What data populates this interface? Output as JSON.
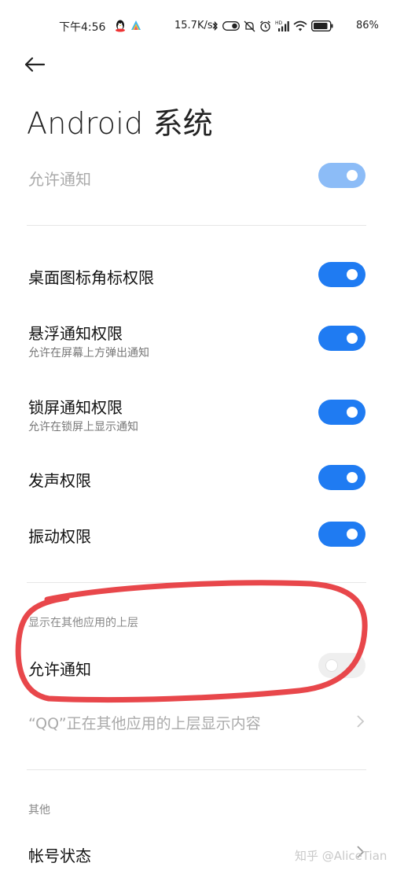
{
  "status_bar": {
    "time": "下午4:56",
    "net_speed": "15.7K/s",
    "battery_percent": "86%",
    "icons": [
      "qq-penguin-icon",
      "bird-app-icon",
      "bluetooth-icon",
      "toggle-icon",
      "mute-icon",
      "alarm-icon",
      "hd-signal-icon",
      "wifi-icon",
      "battery-icon"
    ]
  },
  "header": {
    "back_icon": "back-arrow-icon",
    "title": "Android 系统"
  },
  "allow_notifications_top": {
    "label": "允许通知",
    "state": "on",
    "enabled": false
  },
  "permissions": [
    {
      "title": "桌面图标角标权限",
      "subtitle": "",
      "state": "on"
    },
    {
      "title": "悬浮通知权限",
      "subtitle": "允许在屏幕上方弹出通知",
      "state": "on"
    },
    {
      "title": "锁屏通知权限",
      "subtitle": "允许在锁屏上显示通知",
      "state": "on"
    },
    {
      "title": "发声权限",
      "subtitle": "",
      "state": "on"
    },
    {
      "title": "振动权限",
      "subtitle": "",
      "state": "on"
    }
  ],
  "overlay_section": {
    "header": "显示在其他应用的上层",
    "allow_label": "允许通知",
    "allow_state": "off",
    "description": "“QQ”正在其他应用的上层显示内容"
  },
  "other_section": {
    "header": "其他",
    "account_status": "帐号状态"
  },
  "watermark": "知乎 @AliceTian",
  "colors": {
    "accent": "#1f7bf2",
    "accent_disabled": "#8cbcf7",
    "annotation_red": "#e8474b"
  }
}
